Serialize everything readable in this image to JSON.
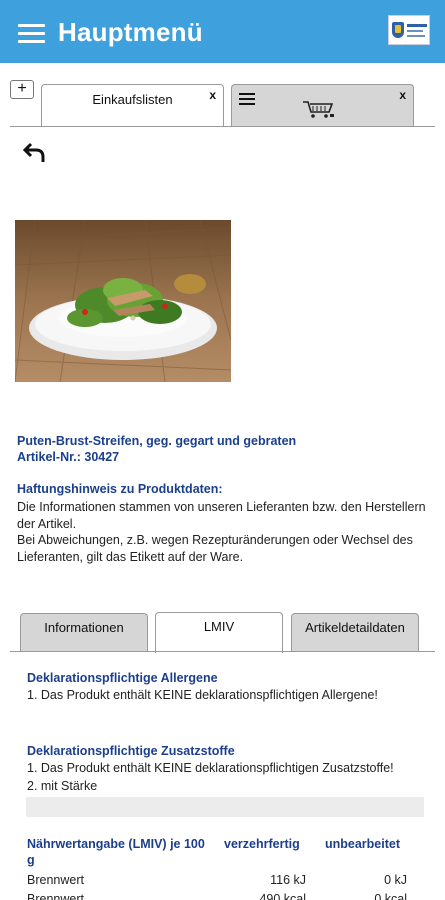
{
  "appbar": {
    "title": "Hauptmenü"
  },
  "tabs": {
    "add_label": "+",
    "active_label": "Einkaufslisten",
    "close_label": "x"
  },
  "product": {
    "title": "Puten-Brust-Streifen, geg. gegart und gebraten",
    "sku": "Artikel-Nr.: 30427"
  },
  "disclaimer": {
    "title": "Haftungshinweis zu Produktdaten:",
    "line1": "Die Informationen stammen von unseren Lieferanten bzw. den Herstellern der Artikel.",
    "line2": "Bei Abweichungen, z.B. wegen Rezepturänderungen oder Wechsel des Lieferanten, gilt das Etikett auf der Ware."
  },
  "detail_tabs": [
    "Informationen",
    "LMIV",
    "Artikeldetaildaten"
  ],
  "allergens": {
    "title": "Deklarationspflichtige Allergene",
    "text": "1. Das Produkt enthält KEINE deklarationspflichtigen Allergene!"
  },
  "additives": {
    "title": "Deklarationspflichtige Zusatzstoffe",
    "text": "1. Das Produkt enthält KEINE deklarationspflichtigen Zusatzstoffe!",
    "item2": "2. mit Stärke"
  },
  "nutrition": {
    "header": "Nährwertangabe (LMIV) je 100 g",
    "col1": "verzehrfertig",
    "col2": "unbearbeitet",
    "rows": [
      {
        "label": "Brennwert",
        "v1": "116 kJ",
        "v2": "0 kJ"
      },
      {
        "label": "Brennwert",
        "v1": "490 kcal",
        "v2": "0 kcal"
      }
    ]
  },
  "colors": {
    "appbar": "#3ea0dc",
    "heading_blue": "#1c3f8c",
    "tab_inactive": "#d6d6d6"
  },
  "icons": [
    "menu-icon",
    "logo",
    "cart-icon",
    "back-arrow-icon"
  ]
}
